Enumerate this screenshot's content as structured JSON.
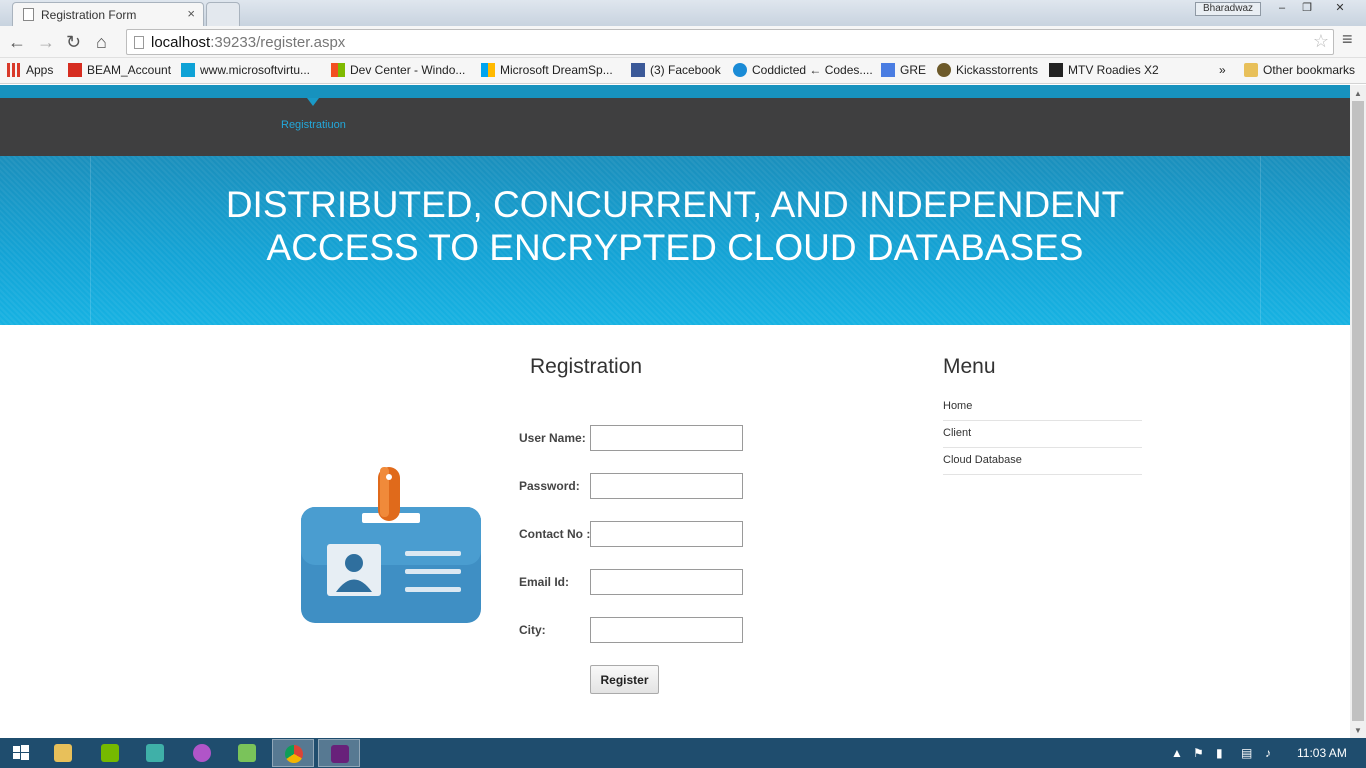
{
  "browser": {
    "tab_title": "Registration Form",
    "tab_close": "×",
    "user_badge": "Bharadwaz",
    "window_controls": {
      "minimize": "–",
      "maximize": "❐",
      "close": "✕"
    },
    "nav": {
      "back": "←",
      "forward": "→",
      "reload": "↻",
      "home": "⌂"
    },
    "url_host": "localhost",
    "url_rest": ":39233/register.aspx",
    "star": "☆",
    "menu": "≡",
    "bookmarks": [
      {
        "label": "Apps",
        "icon": "apps-grid-icon",
        "color": "#d93a2b"
      },
      {
        "label": "BEAM_Account",
        "icon": "act-icon",
        "color": "#d62d20"
      },
      {
        "label": "www.microsoftvirtu...",
        "icon": "mva-icon",
        "color": "#0ea2d6"
      },
      {
        "label": "Dev Center - Windo...",
        "icon": "microsoft-icon",
        "color": "#f25022"
      },
      {
        "label": "Microsoft DreamSp...",
        "icon": "microsoft-icon",
        "color": "#7fba00"
      },
      {
        "label": "(3) Facebook",
        "icon": "facebook-icon",
        "color": "#3b5998"
      },
      {
        "label": "Coddicted ← Codes....",
        "icon": "coddicted-icon",
        "color": "#1a8bd6"
      },
      {
        "label": "GRE",
        "icon": "google-icon",
        "color": "#4a7de2"
      },
      {
        "label": "Kickasstorrents",
        "icon": "kickass-icon",
        "color": "#6d5a2a"
      },
      {
        "label": "MTV Roadies X2",
        "icon": "mtv-icon",
        "color": "#222222"
      }
    ],
    "bookmarks_overflow": "»",
    "other_bookmarks": "Other bookmarks"
  },
  "site": {
    "nav_active": "Registratiuon",
    "hero_title": "DISTRIBUTED, CONCURRENT, AND INDEPENDENT ACCESS TO ENCRYPTED CLOUD DATABASES",
    "form": {
      "heading": "Registration",
      "fields": [
        {
          "label": "User Name:",
          "value": ""
        },
        {
          "label": "Password:",
          "value": ""
        },
        {
          "label": "Contact No :",
          "value": ""
        },
        {
          "label": "Email Id:",
          "value": ""
        },
        {
          "label": "City:",
          "value": ""
        }
      ],
      "submit": "Register"
    },
    "menu": {
      "heading": "Menu",
      "items": [
        "Home",
        "Client",
        "Cloud Database"
      ]
    },
    "colors": {
      "accent": "#1792be",
      "nav_bg": "#3f3f40",
      "nav_link": "#23a7d9"
    }
  },
  "taskbar": {
    "clock": "11:03 AM",
    "tray_expand": "▲"
  }
}
